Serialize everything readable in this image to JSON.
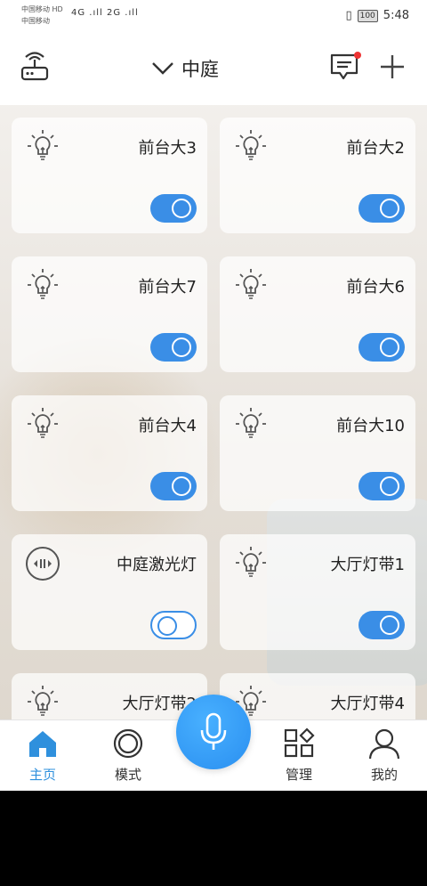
{
  "status_bar": {
    "carrier1": "中国移动 HD",
    "carrier2": "中国移动",
    "signal_text": "4G .ıll 2G .ıll",
    "battery": "100",
    "time": "5:48"
  },
  "header": {
    "title": "中庭",
    "icons": [
      "router-icon",
      "chevron-down-icon",
      "message-icon",
      "plus-icon"
    ],
    "has_notification": true
  },
  "devices": [
    {
      "name": "前台大3",
      "icon": "light-bulb-icon",
      "on": true
    },
    {
      "name": "前台大2",
      "icon": "light-bulb-icon",
      "on": true
    },
    {
      "name": "前台大7",
      "icon": "light-bulb-icon",
      "on": true
    },
    {
      "name": "前台大6",
      "icon": "light-bulb-icon",
      "on": true
    },
    {
      "name": "前台大4",
      "icon": "light-bulb-icon",
      "on": true
    },
    {
      "name": "前台大10",
      "icon": "light-bulb-icon",
      "on": true
    },
    {
      "name": "中庭激光灯",
      "icon": "socket-icon",
      "on": false
    },
    {
      "name": "大厅灯带1",
      "icon": "light-bulb-icon",
      "on": true
    },
    {
      "name": "大厅灯带2",
      "icon": "light-bulb-icon",
      "on": true
    },
    {
      "name": "大厅灯带4",
      "icon": "light-bulb-icon",
      "on": true
    }
  ],
  "tabs": [
    {
      "label": "主页",
      "icon": "home-icon",
      "active": true
    },
    {
      "label": "模式",
      "icon": "mode-icon",
      "active": false
    },
    {
      "label": "管理",
      "icon": "manage-icon",
      "active": false
    },
    {
      "label": "我的",
      "icon": "profile-icon",
      "active": false
    }
  ],
  "colors": {
    "accent": "#3a8ee6",
    "active_tab": "#2f90dd",
    "notification": "#e33333"
  }
}
